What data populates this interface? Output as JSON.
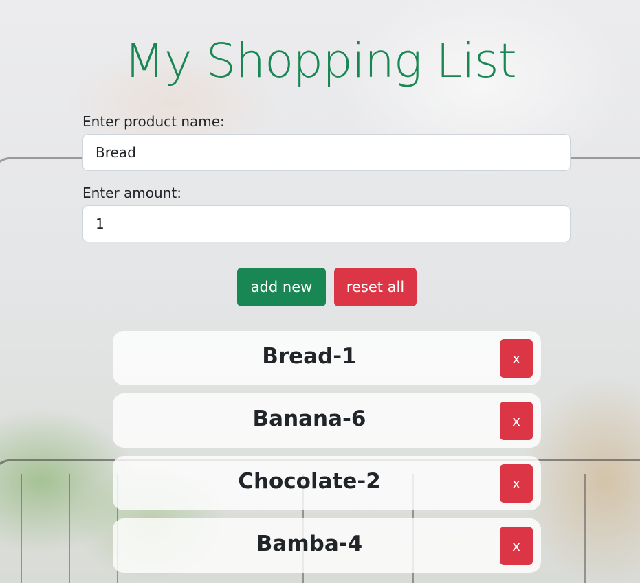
{
  "header": {
    "title": "My Shopping List"
  },
  "form": {
    "product_label": "Enter product name:",
    "product_value": "Bread",
    "amount_label": "Enter amount:",
    "amount_value": "1",
    "add_label": "add new",
    "reset_label": "reset all"
  },
  "list": {
    "items": [
      {
        "text": "Bread-1",
        "delete_label": "x"
      },
      {
        "text": "Banana-6",
        "delete_label": "x"
      },
      {
        "text": "Chocolate-2",
        "delete_label": "x"
      },
      {
        "text": "Bamba-4",
        "delete_label": "x"
      }
    ]
  },
  "colors": {
    "primary_green": "#198754",
    "danger_red": "#dc3545",
    "text_dark": "#212529"
  }
}
